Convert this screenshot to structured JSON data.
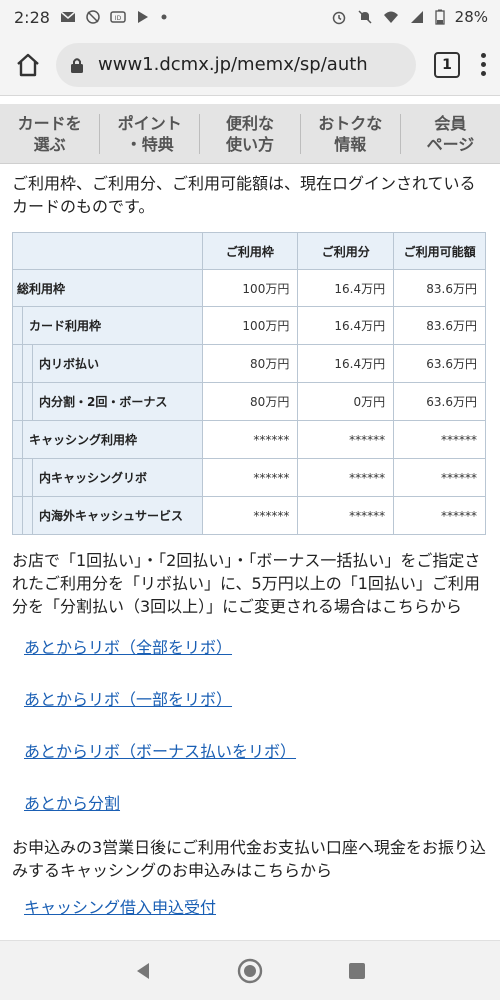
{
  "status_bar": {
    "time": "2:28",
    "battery": "28%"
  },
  "browser": {
    "url": "www1.dcmx.jp/memx/sp/auth",
    "tab_count": "1"
  },
  "site_nav": {
    "items": [
      {
        "label": "カードを\n選ぶ"
      },
      {
        "label": "ポイント\n・特典"
      },
      {
        "label": "便利な\n使い方"
      },
      {
        "label": "おトクな\n情報"
      },
      {
        "label": "会員\nページ"
      }
    ]
  },
  "intro_text": "ご利用枠、ご利用分、ご利用可能額は、現在ログインされているカードのものです。",
  "limits_table": {
    "headers": [
      "",
      "ご利用枠",
      "ご利用分",
      "ご利用可能額"
    ],
    "rows": [
      {
        "label": "総利用枠",
        "values": [
          "100万円",
          "16.4万円",
          "83.6万円"
        ]
      },
      {
        "label": "カード利用枠",
        "values": [
          "100万円",
          "16.4万円",
          "83.6万円"
        ]
      },
      {
        "label": "内リボ払い",
        "values": [
          "80万円",
          "16.4万円",
          "63.6万円"
        ]
      },
      {
        "label": "内分割・2回・ボーナス",
        "values": [
          "80万円",
          "0万円",
          "63.6万円"
        ]
      },
      {
        "label": "キャッシング利用枠",
        "values": [
          "******",
          "******",
          "******"
        ]
      },
      {
        "label": "内キャッシングリボ",
        "values": [
          "******",
          "******",
          "******"
        ]
      },
      {
        "label": "内海外キャッシュサービス",
        "values": [
          "******",
          "******",
          "******"
        ]
      }
    ]
  },
  "para1": "お店で「1回払い」・「2回払い」・「ボーナス一括払い」をご指定されたご利用分を「リボ払い」に、5万円以上の「1回払い」ご利用分を「分割払い（3回以上）」にご変更される場合はこちらから",
  "links1": [
    "あとからリボ（全部をリボ）",
    "あとからリボ（一部をリボ）",
    "あとからリボ（ボーナス払いをリボ）",
    "あとから分割"
  ],
  "para2": "お申込みの3営業日後にご利用代金お支払い口座へ現金をお振り込みするキャッシングのお申込みはこちらから",
  "link2": "キャッシング借入申込受付",
  "colors": {
    "link": "#1a5fb4",
    "table_header_bg": "#e8f0f8",
    "nav_bg": "#e4e4e4"
  }
}
